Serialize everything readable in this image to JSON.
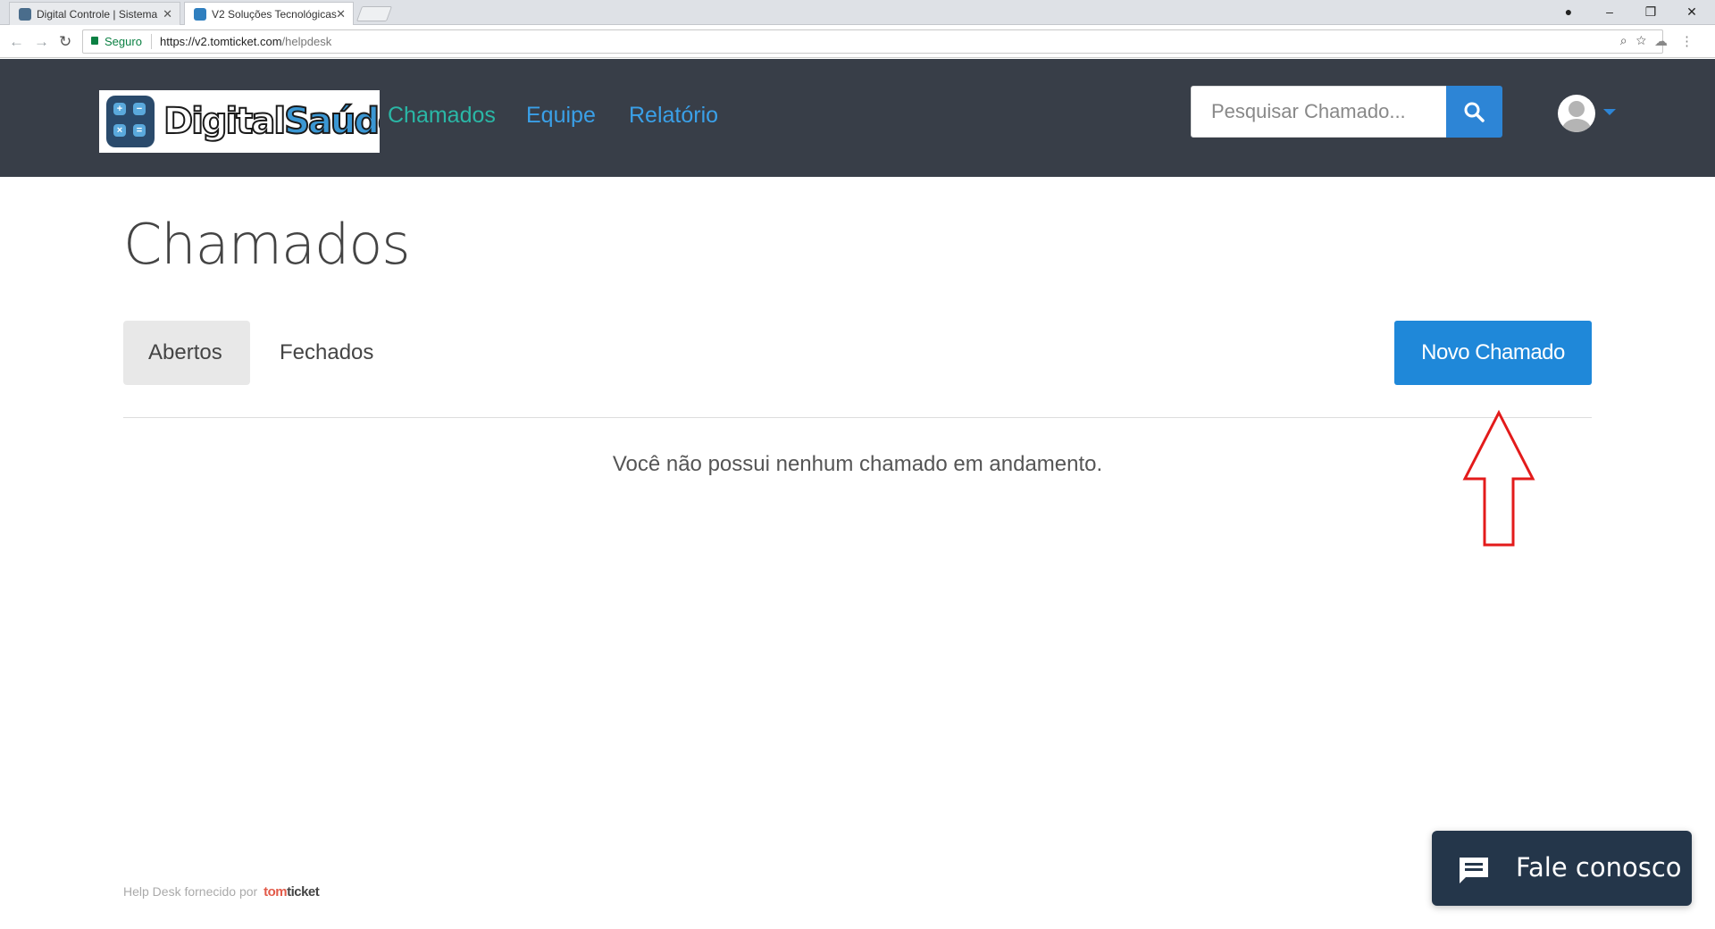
{
  "browser": {
    "tabs": [
      {
        "title": "Digital Controle | Sistema",
        "close": "✕"
      },
      {
        "title": "V2 Soluções Tecnológicas",
        "close": "✕"
      }
    ],
    "security_label": "Seguro",
    "url_host": "https://v2.tomticket.com",
    "url_path": "/helpdesk"
  },
  "header": {
    "logo": {
      "text_a": "Digital",
      "text_b": "Saúde"
    },
    "nav": [
      "Chamados",
      "Equipe",
      "Relatório"
    ],
    "search_placeholder": "Pesquisar Chamado..."
  },
  "main": {
    "title": "Chamados",
    "tabs": [
      "Abertos",
      "Fechados"
    ],
    "new_button": "Novo Chamado",
    "empty_message": "Você não possui nenhum chamado em andamento."
  },
  "footer": {
    "text": "Help Desk fornecido por",
    "brand_a": "tom",
    "brand_b": "ticket"
  },
  "chat": {
    "label": "Fale conosco"
  },
  "colors": {
    "header_bg": "#383e48",
    "primary": "#1f88d9",
    "active_nav": "#2ab7a6",
    "nav": "#3aa0e8",
    "annotation": "#e31b1b"
  }
}
